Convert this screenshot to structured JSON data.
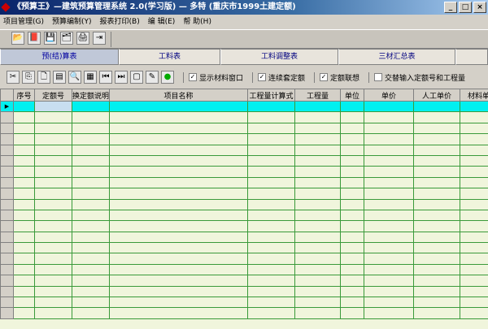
{
  "window": {
    "title": "《预算王》—建筑预算管理系统 2.0(学习版) — 多特 (重庆市1999土建定额)",
    "minimize": "_",
    "maximize": "□",
    "close": "×"
  },
  "menu": [
    "项目管理(G)",
    "预算编制(Y)",
    "报表打印(B)",
    "编  辑(E)",
    "帮  助(H)"
  ],
  "toolbar": {
    "icons": [
      "open-folder-icon",
      "book-icon",
      "save-icon",
      "save-as-icon",
      "print-icon",
      "exit-icon"
    ],
    "glyphs": [
      "📂",
      "📕",
      "💾",
      "🗂",
      "🖨",
      "⇥"
    ]
  },
  "tabs": [
    "预(结)算表",
    "工料表",
    "工料调整表",
    "三材汇总表"
  ],
  "edit_toolbar": {
    "glyphs": [
      "✂",
      "⎘",
      "🗋",
      "▤",
      "🔍",
      "▦",
      "⏮",
      "⏭",
      "▢",
      "✎",
      "●"
    ],
    "checkboxes": [
      {
        "label": "显示材料窗口",
        "checked": true
      },
      {
        "label": "连续套定额",
        "checked": true
      },
      {
        "label": "定额联想",
        "checked": true
      },
      {
        "label": "交替输入定额号和工程量",
        "checked": false
      }
    ]
  },
  "grid": {
    "columns": [
      "",
      "序号",
      "定额号",
      "换定额说明",
      "项目名称",
      "工程量计算式",
      "工程量",
      "单位",
      "单价",
      "人工单价",
      "材料单价"
    ],
    "row_marker": "▶",
    "row_count": 20
  }
}
